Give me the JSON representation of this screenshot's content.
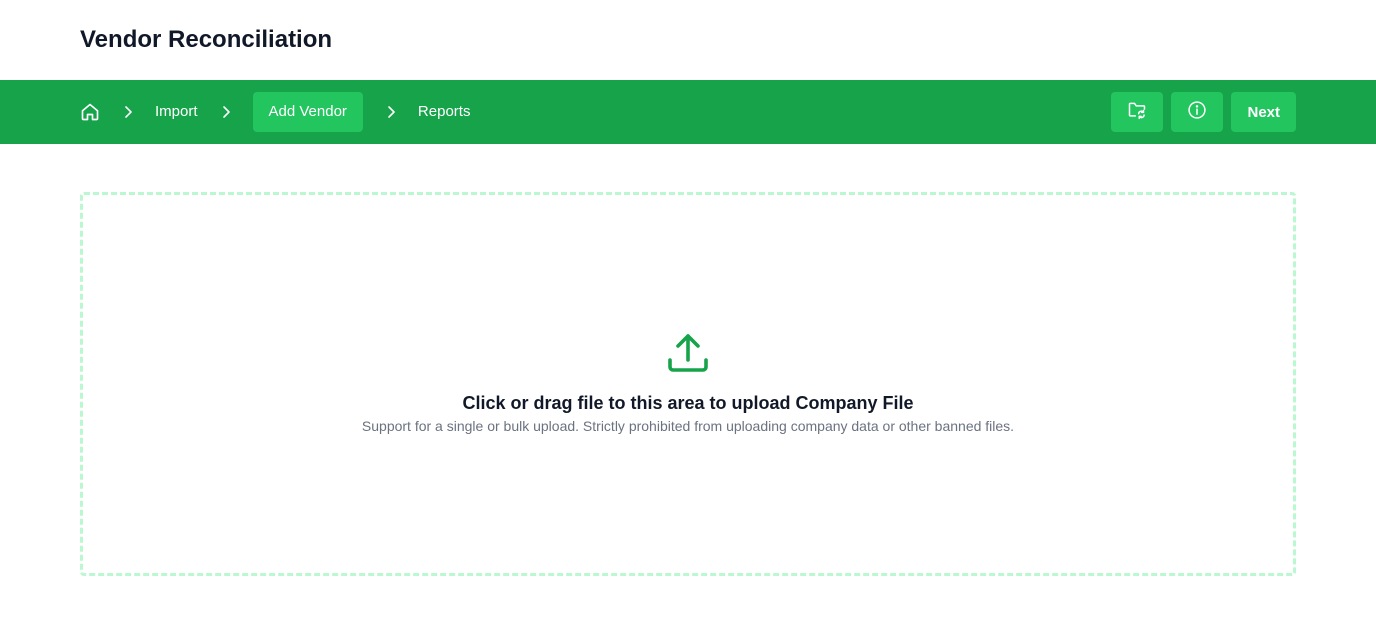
{
  "app": {
    "title": "Vendor Reconciliation"
  },
  "breadcrumb": {
    "home_icon": "home-icon",
    "items": [
      {
        "label": "Import",
        "active": false
      },
      {
        "label": "Add Vendor",
        "active": true
      },
      {
        "label": "Reports",
        "active": false
      }
    ]
  },
  "actions": {
    "folder_sync_icon": "folder-sync-icon",
    "info_icon": "info-icon",
    "next_label": "Next"
  },
  "upload": {
    "icon": "upload-icon",
    "title": "Click or drag file to this area to upload Company File",
    "hint": "Support for a single or bulk upload. Strictly prohibited from uploading company data or other banned files."
  },
  "colors": {
    "nav_background": "#16a34a",
    "active_crumb": "#22c55e",
    "button_background": "#22c55e",
    "dropzone_border": "#bbf7d0",
    "upload_icon": "#16a34a",
    "title_text": "#111827",
    "hint_text": "#6b7280"
  }
}
